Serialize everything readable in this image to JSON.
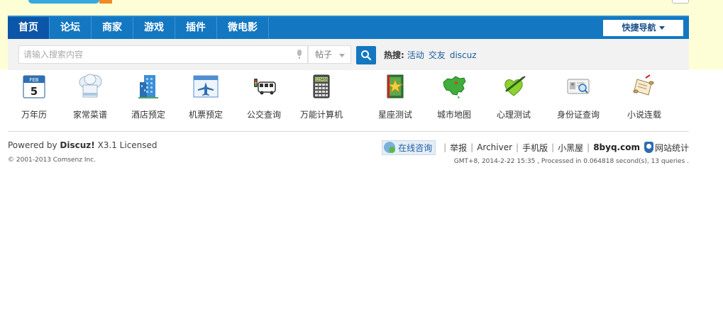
{
  "nav": {
    "items": [
      {
        "label": "首页",
        "active": true
      },
      {
        "label": "论坛",
        "active": false
      },
      {
        "label": "商家",
        "active": false
      },
      {
        "label": "游戏",
        "active": false
      },
      {
        "label": "插件",
        "active": false
      },
      {
        "label": "微电影",
        "active": false
      }
    ],
    "quick_nav": "快捷导航"
  },
  "search": {
    "placeholder": "请输入搜索内容",
    "type_selected": "帖子",
    "hot_label": "热搜:",
    "hot_terms": [
      "活动",
      "交友",
      "discuz"
    ]
  },
  "apps": [
    {
      "label": "万年历",
      "icon": "calendar-icon"
    },
    {
      "label": "家常菜谱",
      "icon": "chef-hat-icon"
    },
    {
      "label": "酒店预定",
      "icon": "hotel-building-icon"
    },
    {
      "label": "机票预定",
      "icon": "flight-ticket-icon"
    },
    {
      "label": "公交查询",
      "icon": "bus-icon"
    },
    {
      "label": "万能计算机",
      "icon": "calculator-icon"
    },
    {
      "label": "星座测试",
      "icon": "star-book-icon"
    },
    {
      "label": "城市地图",
      "icon": "china-map-icon"
    },
    {
      "label": "心理测试",
      "icon": "heart-pen-icon"
    },
    {
      "label": "身份证查询",
      "icon": "id-card-icon"
    },
    {
      "label": "小说连载",
      "icon": "scroll-book-icon"
    }
  ],
  "calendar_icon": {
    "month": "FEB",
    "day": "5"
  },
  "calculator_icon_text": "123456",
  "footer": {
    "powered_prefix": "Powered by",
    "powered_brand": "Discuz!",
    "powered_suffix": "X3.1 Licensed",
    "copyright": "© 2001-2013 Comsenz Inc.",
    "consult": "在线咨询",
    "links": [
      "举报",
      "Archiver",
      "手机版",
      "小黑屋"
    ],
    "site": "8byq.com",
    "stats": "网站统计",
    "status": "GMT+8, 2014-2-22 15:35 , Processed in 0.064818 second(s), 13 queries ."
  },
  "colors": {
    "nav_bg": "#1377c1",
    "nav_active": "#0b56a8",
    "top_band": "#fefed6",
    "link": "#1a5c9e"
  }
}
